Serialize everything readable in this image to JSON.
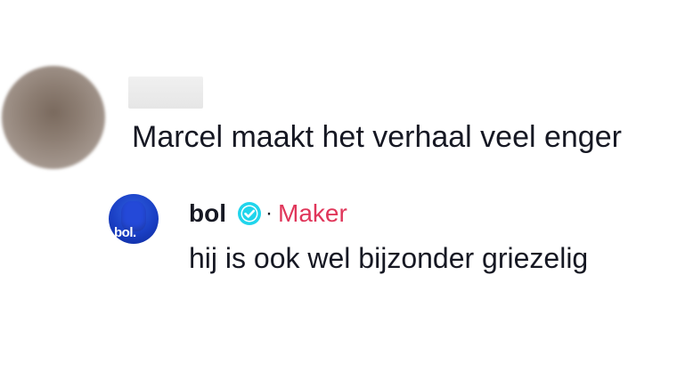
{
  "comment": {
    "username": "",
    "text": "Marcel maakt het verhaal veel enger"
  },
  "reply": {
    "avatar_logo": "bol.",
    "username": "bol",
    "verified_icon": "verified-check-icon",
    "separator": "·",
    "badge": "Maker",
    "text": "hij is ook wel bijzonder griezelig"
  },
  "colors": {
    "text": "#161823",
    "maker": "#e0365a",
    "verified": "#20d5ec",
    "bol_blue": "#1a3fc4"
  }
}
